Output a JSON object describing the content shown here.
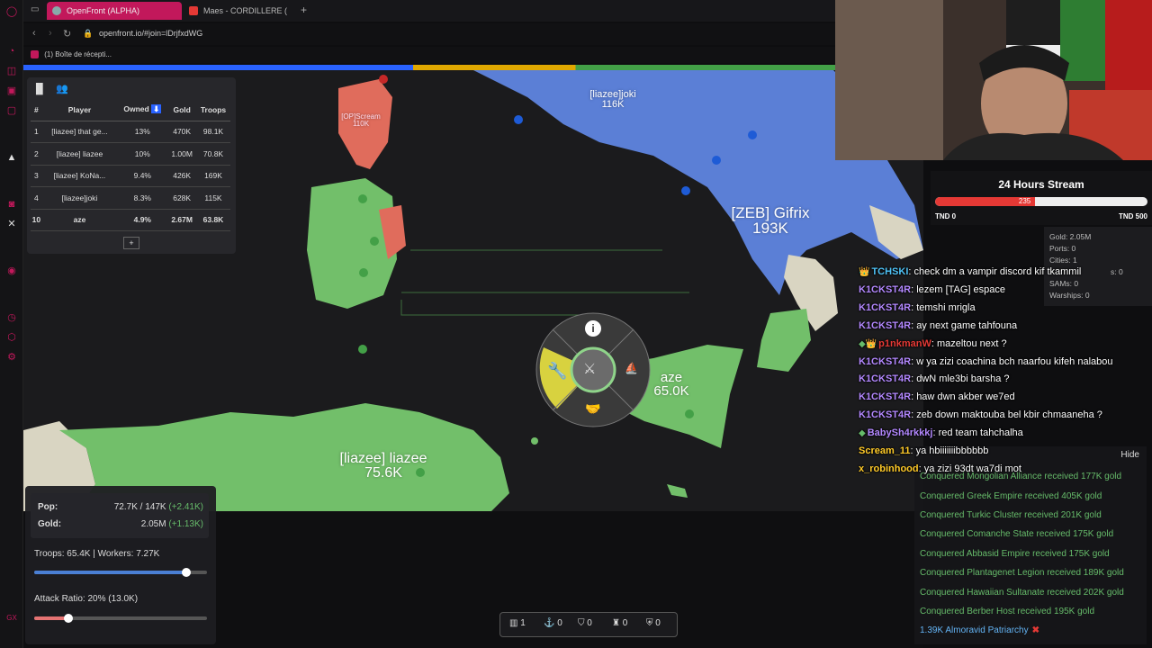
{
  "browser": {
    "tabs": [
      {
        "label": "OpenFront (ALPHA)",
        "active": true
      },
      {
        "label": "Maes - CORDILLERE (",
        "active": false
      }
    ],
    "new_tab": "+",
    "url": "openfront.io/#join=lDrjfxdWG",
    "bookmark": "(1) Boîte de récepti..."
  },
  "leaderboard": {
    "headers": [
      "#",
      "Player",
      "Owned",
      "Gold",
      "Troops"
    ],
    "rows": [
      {
        "rank": "1",
        "player": "[liazee] that ge...",
        "owned": "13%",
        "gold": "470K",
        "troops": "98.1K"
      },
      {
        "rank": "2",
        "player": "[liazee] liazee",
        "owned": "10%",
        "gold": "1.00M",
        "troops": "70.8K"
      },
      {
        "rank": "3",
        "player": "[liazee] KoNa...",
        "owned": "9.4%",
        "gold": "426K",
        "troops": "169K"
      },
      {
        "rank": "4",
        "player": "[liazee]joki",
        "owned": "8.3%",
        "gold": "628K",
        "troops": "115K"
      },
      {
        "rank": "10",
        "player": "aze",
        "owned": "4.9%",
        "gold": "2.67M",
        "troops": "63.8K"
      }
    ],
    "more": "+"
  },
  "map_labels": {
    "joki_name": "[liazee]joki",
    "joki_troops": "116K",
    "scream_name": "[OP]Scream",
    "scream_troops": "110K",
    "gifrix_name": "[ZEB] Gifrix",
    "gifrix_troops": "193K",
    "aze_name": "aze",
    "aze_troops": "65.0K",
    "liazee_name": "[liazee] liazee",
    "liazee_troops": "75.6K"
  },
  "stats": {
    "pop_label": "Pop:",
    "pop_value": "72.7K / 147K",
    "pop_delta": "(+2.41K)",
    "gold_label": "Gold:",
    "gold_value": "2.05M",
    "gold_delta": "(+1.13K)",
    "troops_workers": "Troops: 65.4K | Workers: 7.27K",
    "troops_ratio": 0.88,
    "attack_ratio": "Attack Ratio: 20% (13.0K)",
    "attack_fraction": 0.2
  },
  "bottom_bar": [
    {
      "icon": "city-icon",
      "count": "1"
    },
    {
      "icon": "port-icon",
      "count": "0"
    },
    {
      "icon": "defense-post-icon",
      "count": "0"
    },
    {
      "icon": "missile-silo-icon",
      "count": "0"
    },
    {
      "icon": "sam-launcher-icon",
      "count": "0"
    }
  ],
  "stream": {
    "title": "24 Hours Stream",
    "current": "235",
    "fraction": 0.47,
    "min": "TND 0",
    "max": "TND 500"
  },
  "player_info": {
    "gold": "Gold: 2.05M",
    "ports": "Ports: 0",
    "cities": "Cities: 1",
    "missiles": "s: 0",
    "sams": "SAMs: 0",
    "warships": "Warships: 0"
  },
  "chat": [
    {
      "badge": "crown",
      "user": "TCHSKI",
      "color": "#4fc3f7",
      "text": ": check dm a vampir discord kif tkammil"
    },
    {
      "badge": "",
      "user": "K1CKST4R",
      "color": "#b388ff",
      "text": ": lezem [TAG] espace"
    },
    {
      "badge": "",
      "user": "K1CKST4R",
      "color": "#b388ff",
      "text": ": temshi mrigla"
    },
    {
      "badge": "",
      "user": "K1CKST4R",
      "color": "#b388ff",
      "text": ": ay next game tahfouna"
    },
    {
      "badge": "gem-crown",
      "user": "p1nkmanW",
      "color": "#e53935",
      "text": ": mazeltou next ?"
    },
    {
      "badge": "",
      "user": "K1CKST4R",
      "color": "#b388ff",
      "text": ": w ya zizi coachina bch naarfou kifeh nalabou"
    },
    {
      "badge": "",
      "user": "K1CKST4R",
      "color": "#b388ff",
      "text": ": dwN mle3bi barsha ?"
    },
    {
      "badge": "",
      "user": "K1CKST4R",
      "color": "#b388ff",
      "text": ": haw dwn akber we7ed"
    },
    {
      "badge": "",
      "user": "K1CKST4R",
      "color": "#b388ff",
      "text": ": zeb down maktouba bel kbir chmaaneha ?"
    },
    {
      "badge": "gem",
      "user": "BabySh4rkkkj",
      "color": "#b388ff",
      "text": ": red team tahchalha"
    },
    {
      "badge": "",
      "user": "Scream_11",
      "color": "#ffca28",
      "text": ": ya hbiiiiiiibbbbbb"
    },
    {
      "badge": "",
      "user": "x_robinhood",
      "color": "#ffca28",
      "text": ": ya zizi 93dt wa7di mot"
    }
  ],
  "events": {
    "hide": "Hide",
    "items": [
      "Conquered Mongolian Alliance received 177K gold",
      "Conquered Greek Empire received 405K gold",
      "Conquered Turkic Cluster received 201K gold",
      "Conquered Comanche State received 175K gold",
      "Conquered Abbasid Empire received 175K gold",
      "Conquered Plantagenet Legion received 189K gold",
      "Conquered Hawaiian Sultanate received 202K gold",
      "Conquered Berber Host received 195K gold"
    ],
    "last": "1.39K Almoravid Patriarchy",
    "last_close": "✖"
  },
  "colors": {
    "green_land": "#72bf6a",
    "blue_land": "#5b7fd6",
    "red_land": "#e06c5c",
    "neutral_land": "#d9d5c2",
    "accent": "#c2185b"
  }
}
